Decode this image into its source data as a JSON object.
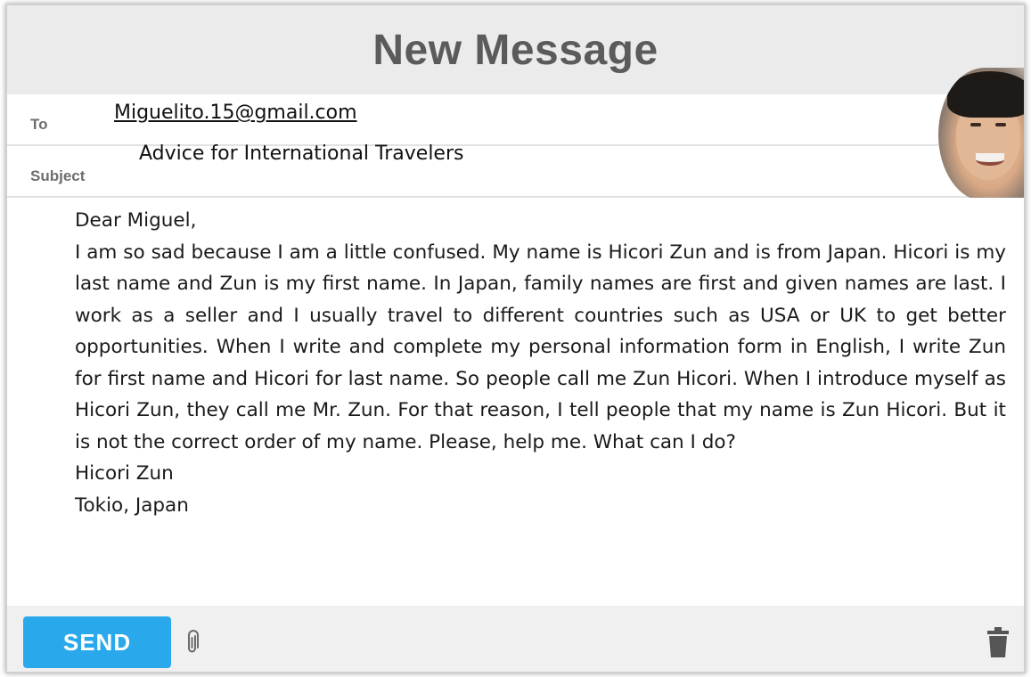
{
  "window": {
    "title": "New Message"
  },
  "fields": {
    "to_label": "To",
    "to_value": "Miguelito.15@gmail.com",
    "subject_label": "Subject",
    "subject_value": "Advice for International Travelers"
  },
  "body": {
    "greeting": "Dear Miguel,",
    "paragraph": "I am so sad because I am a little confused. My name is Hicori Zun and is from Japan. Hicori is my last name and Zun is my first name. In Japan, family names are first and given names are last. I work as a seller and I usually travel to different countries such as USA or UK to get better opportunities. When I write and complete my personal information form in English, I write Zun for first name and Hicori for last name. So people call me Zun Hicori. When I introduce myself as Hicori Zun, they call me Mr. Zun. For that reason, I tell people that my name is Zun Hicori. But it is not the correct order of my name. Please, help me. What can I do?",
    "signature_name": "Hicori Zun",
    "signature_location": "Tokio, Japan"
  },
  "footer": {
    "send_label": "SEND",
    "attach_icon": "paperclip-icon",
    "delete_icon": "trash-icon"
  },
  "colors": {
    "send_button": "#29a9ec",
    "title_bar": "#ebebeb",
    "title_text": "#5b5b5b",
    "footer_bg": "#f0f0f0"
  }
}
